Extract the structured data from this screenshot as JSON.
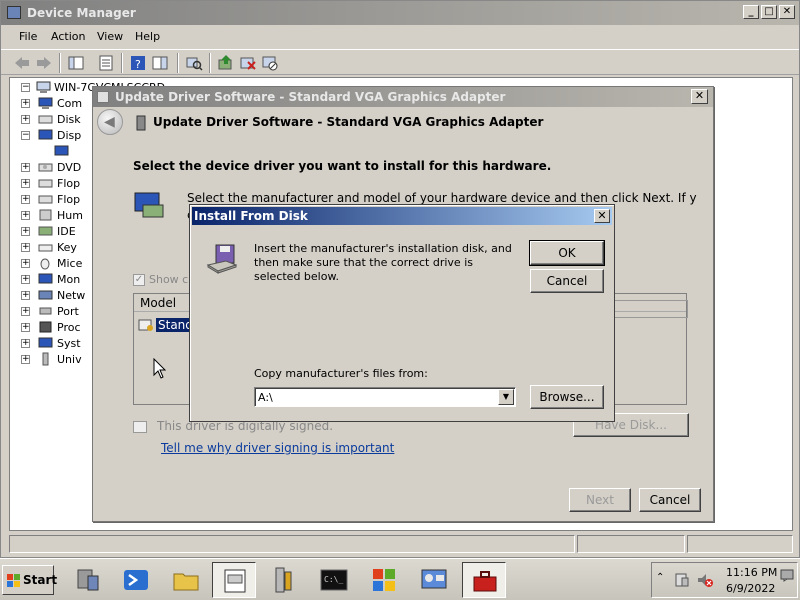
{
  "device_manager": {
    "title": "Device Manager",
    "menu": [
      "File",
      "Action",
      "View",
      "Help"
    ],
    "tree": {
      "root": "WIN-7GVCMLSCCRD",
      "items": [
        "Com",
        "Disk",
        "Disp",
        "DVD",
        "Flop",
        "Flop",
        "Hum",
        "IDE",
        "Key",
        "Mice",
        "Mon",
        "Netw",
        "Port",
        "Proc",
        "Syst",
        "Univ"
      ]
    }
  },
  "update_driver": {
    "title": "Update Driver Software - Standard VGA Graphics Adapter",
    "header": "Update Driver Software - Standard VGA Graphics Adapter",
    "prompt": "Select the device driver you want to install for this hardware.",
    "description_line1": "Select the manufacturer and model of your hardware device and then click Next. If you have a",
    "description_line2": "c",
    "show_compatible": "Show c",
    "model_column": "Model",
    "model_item": "Stand",
    "signed_text": "This driver is digitally signed.",
    "signing_link": "Tell me why driver signing is important",
    "have_disk": "Have Disk...",
    "next": "Next",
    "cancel": "Cancel"
  },
  "install_from_disk": {
    "title": "Install From Disk",
    "message": "Insert the manufacturer's installation disk, and then make sure that the correct drive is selected below.",
    "ok": "OK",
    "cancel": "Cancel",
    "copy_label": "Copy manufacturer's files from:",
    "copy_value": "A:\\",
    "browse": "Browse..."
  },
  "taskbar": {
    "start": "Start",
    "apps": [
      "server-manager-icon",
      "powershell-icon",
      "explorer-icon",
      "device-manager-icon",
      "tools-icon",
      "cmd-icon",
      "ie-icon",
      "control-panel-icon",
      "toolbox-icon"
    ],
    "active_app": "toolbox-icon",
    "time": "11:16 PM",
    "date": "6/9/2022"
  },
  "colors": {
    "active_title": "#0a246a",
    "inactive_title": "#808080",
    "face": "#d4d0c8",
    "link": "#0b3b9c"
  }
}
